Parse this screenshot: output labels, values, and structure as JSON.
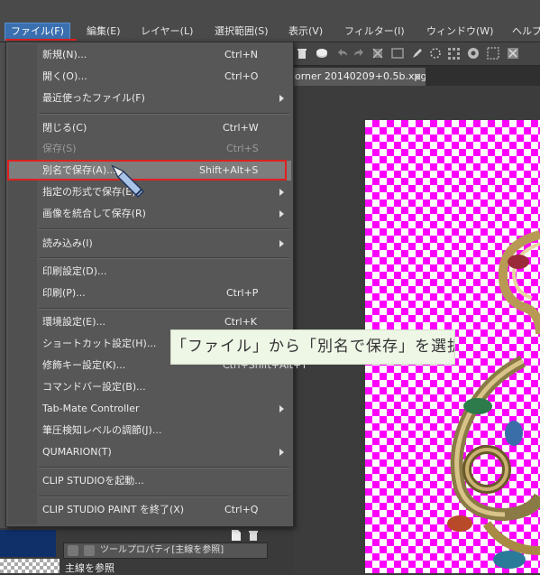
{
  "menubar": {
    "items": [
      {
        "label": "ファイル(F)",
        "active": true
      },
      {
        "label": "編集(E)"
      },
      {
        "label": "レイヤー(L)"
      },
      {
        "label": "選択範囲(S)"
      },
      {
        "label": "表示(V)"
      },
      {
        "label": "フィルター(I)"
      },
      {
        "label": "ウィンドウ(W)"
      },
      {
        "label": "ヘルプ"
      }
    ]
  },
  "document_tab": {
    "title": "orner 20140209+0.5b.xpg",
    "close": "×"
  },
  "file_menu": {
    "items": [
      {
        "label": "新規(N)...",
        "shortcut": "Ctrl+N"
      },
      {
        "label": "開く(O)...",
        "shortcut": "Ctrl+O"
      },
      {
        "label": "最近使ったファイル(F)",
        "submenu": true
      },
      {
        "label": "閉じる(C)",
        "shortcut": "Ctrl+W"
      },
      {
        "label": "保存(S)",
        "shortcut": "Ctrl+S",
        "disabled": true
      },
      {
        "label": "別名で保存(A)...",
        "shortcut": "Shift+Alt+S",
        "highlighted": true
      },
      {
        "label": "指定の形式で保存(E)",
        "submenu": true
      },
      {
        "label": "画像を統合して保存(R)",
        "submenu": true
      },
      {
        "label": "読み込み(I)",
        "submenu": true
      },
      {
        "label": "印刷設定(D)..."
      },
      {
        "label": "印刷(P)...",
        "shortcut": "Ctrl+P"
      },
      {
        "label": "環境設定(E)...",
        "shortcut": "Ctrl+K"
      },
      {
        "label": "ショートカット設定(H)..."
      },
      {
        "label": "修飾キー設定(K)...",
        "shortcut": "Ctrl+Shift+Alt+Y"
      },
      {
        "label": "コマンドバー設定(B)..."
      },
      {
        "label": "Tab-Mate Controller",
        "submenu": true
      },
      {
        "label": "筆圧検知レベルの調節(J)..."
      },
      {
        "label": "QUMARION(T)",
        "submenu": true
      },
      {
        "label": "CLIP STUDIOを起動..."
      },
      {
        "label": "CLIP STUDIO PAINT を終了(X)",
        "shortcut": "Ctrl+Q"
      }
    ]
  },
  "annotation": {
    "text": "「ファイル」から「別名で保存」を選択"
  },
  "bottom_panel": {
    "tool_property_tab": "ツールプロパティ[主線を参照]",
    "layer_label": "主線を参照"
  },
  "colors": {
    "menu_bg": "#575757",
    "menubar_active": "#3a6fb0",
    "highlight_box": "#e02020",
    "transparency_checker": "#ff00ff",
    "annotation_bg": "#eef6e6"
  }
}
